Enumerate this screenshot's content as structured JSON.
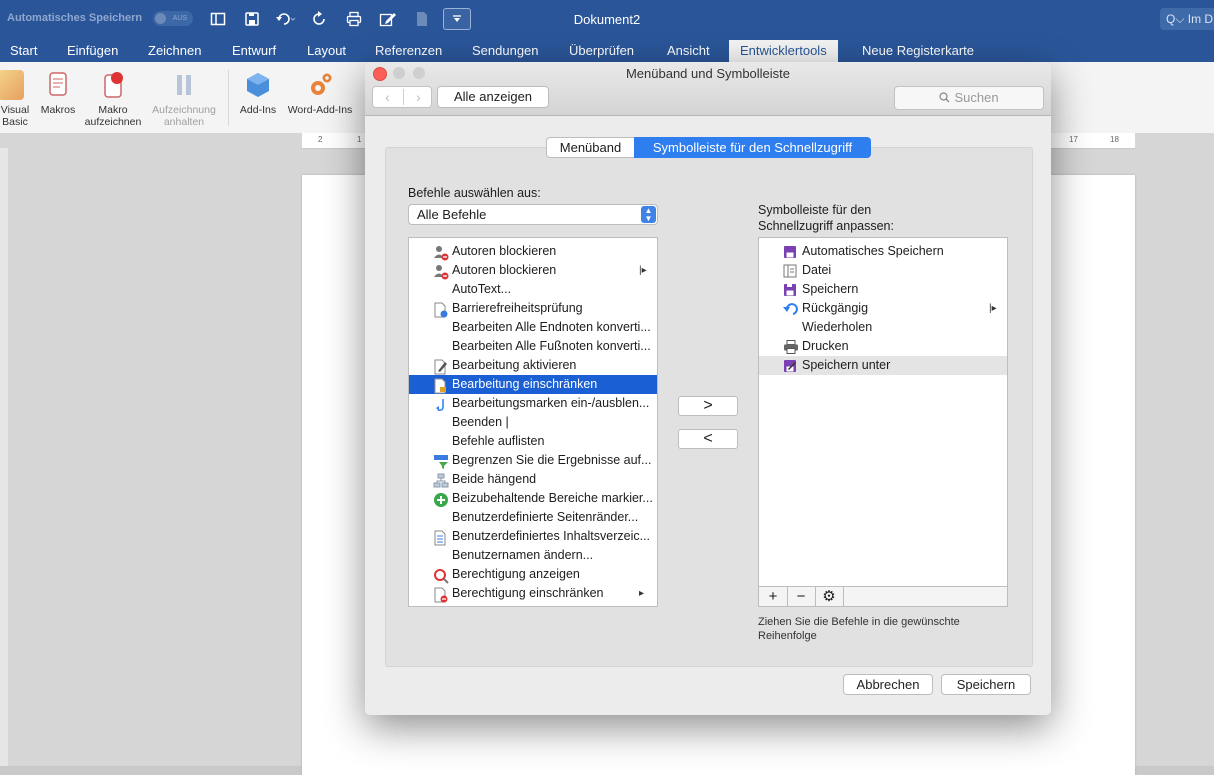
{
  "titlebar": {
    "autosave_label": "Automatisches Speichern",
    "toggle_label": "AUS",
    "doc_title": "Dokument2",
    "search_text": "Q⌵ Im D"
  },
  "ribbon_tabs": [
    "Start",
    "Einfügen",
    "Zeichnen",
    "Entwurf",
    "Layout",
    "Referenzen",
    "Sendungen",
    "Überprüfen",
    "Ansicht",
    "Entwicklertools",
    "Neue Registerkarte"
  ],
  "ribbon_buttons": {
    "visual_basic": [
      "Visual",
      "Basic"
    ],
    "makros": "Makros",
    "makro_aufzeichnen": [
      "Makro",
      "aufzeichnen"
    ],
    "aufzeichnung_anhalten": [
      "Aufzeichnung",
      "anhalten"
    ],
    "add_ins": "Add-Ins",
    "word_add_ins": "Word-Add-Ins"
  },
  "ruler_marks": [
    "2",
    "1",
    "17",
    "18"
  ],
  "dialog": {
    "title": "Menüband und Symbolleiste",
    "show_all": "Alle anzeigen",
    "search_placeholder": "Suchen",
    "tab_ribbon": "Menüband",
    "tab_qat": "Symbolleiste für den Schnellzugriff",
    "choose_label": "Befehle auswählen aus:",
    "choose_value": "Alle Befehle",
    "customize_label_1": "Symbolleiste für den",
    "customize_label_2": "Schnellzugriff anpassen:",
    "hint": "Ziehen Sie die Befehle in die gewünschte Reihenfolge",
    "cancel": "Abbrechen",
    "save": "Speichern",
    "add_arrow": ">",
    "remove_arrow": "<",
    "plus": "+",
    "minus": "−",
    "gear": "⚙",
    "commands": [
      {
        "label": "Autoren blockieren",
        "icon": "authors-block-icon",
        "submenu": ""
      },
      {
        "label": "Autoren blockieren",
        "icon": "authors-block-icon",
        "submenu": "|▸"
      },
      {
        "label": "AutoText...",
        "icon": "",
        "submenu": ""
      },
      {
        "label": "Barrierefreiheitsprüfung",
        "icon": "accessibility-check-icon",
        "submenu": ""
      },
      {
        "label": "Bearbeiten Alle Endnoten konverti...",
        "icon": "",
        "submenu": ""
      },
      {
        "label": "Bearbeiten Alle Fußnoten konverti...",
        "icon": "",
        "submenu": ""
      },
      {
        "label": "Bearbeitung aktivieren",
        "icon": "edit-enable-icon",
        "submenu": ""
      },
      {
        "label": "Bearbeitung einschränken",
        "icon": "restrict-editing-icon",
        "submenu": ""
      },
      {
        "label": "Bearbeitungsmarken ein-/ausblen...",
        "icon": "paragraph-marks-icon",
        "submenu": ""
      },
      {
        "label": "Beenden |",
        "icon": "",
        "submenu": ""
      },
      {
        "label": "Befehle auflisten",
        "icon": "",
        "submenu": ""
      },
      {
        "label": "Begrenzen Sie die Ergebnisse auf...",
        "icon": "filter-results-icon",
        "submenu": ""
      },
      {
        "label": "Beide hängend",
        "icon": "hanging-icon",
        "submenu": ""
      },
      {
        "label": "Beizubehaltende Bereiche markier...",
        "icon": "mark-areas-icon",
        "submenu": ""
      },
      {
        "label": "Benutzerdefinierte Seitenränder...",
        "icon": "",
        "submenu": ""
      },
      {
        "label": "Benutzerdefiniertes Inhaltsverzeic...",
        "icon": "toc-icon",
        "submenu": ""
      },
      {
        "label": "Benutzernamen ändern...",
        "icon": "",
        "submenu": ""
      },
      {
        "label": "Berechtigung anzeigen",
        "icon": "permission-view-icon",
        "submenu": ""
      },
      {
        "label": "Berechtigung einschränken",
        "icon": "permission-restrict-icon",
        "submenu": "▸"
      }
    ],
    "qat_items": [
      {
        "label": "Automatisches Speichern",
        "icon": "autosave-icon",
        "submenu": ""
      },
      {
        "label": "Datei",
        "icon": "file-icon",
        "submenu": ""
      },
      {
        "label": "Speichern",
        "icon": "save-icon",
        "submenu": ""
      },
      {
        "label": "Rückgängig",
        "icon": "undo-icon",
        "submenu": "|▸"
      },
      {
        "label": "Wiederholen",
        "icon": "",
        "submenu": ""
      },
      {
        "label": "Drucken",
        "icon": "print-icon",
        "submenu": ""
      },
      {
        "label": "Speichern unter",
        "icon": "save-as-icon",
        "submenu": ""
      }
    ],
    "selected_command_index": 7,
    "highlighted_qat_index": 6
  },
  "colors": {
    "title_blue": "#2a5699",
    "selection_blue": "#1a5fd4",
    "save_purple": "#7a3fb3"
  }
}
